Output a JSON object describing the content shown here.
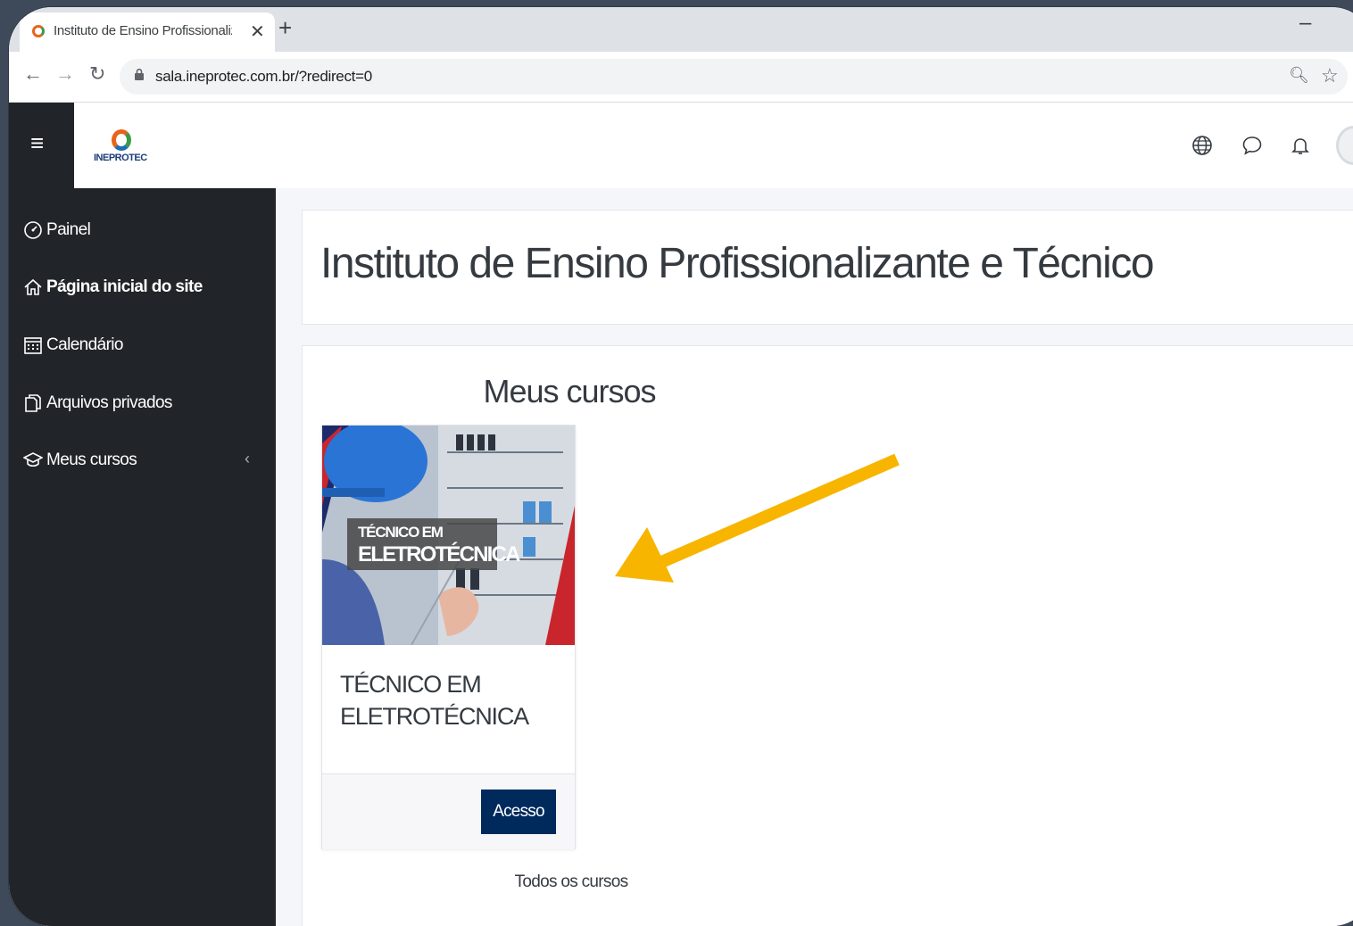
{
  "browser": {
    "tab_title": "Instituto de Ensino Profissionalizante e Técnico",
    "tab_close": "✕",
    "new_tab": "+",
    "minimize": "–",
    "url": "sala.ineprotec.com.br/?redirect=0"
  },
  "header": {
    "logo_text": "INEPROTEC"
  },
  "sidebar": {
    "items": [
      {
        "label": "Painel",
        "icon": "dashboard-icon"
      },
      {
        "label": "Página inicial do site",
        "icon": "home-icon"
      },
      {
        "label": "Calendário",
        "icon": "calendar-icon"
      },
      {
        "label": "Arquivos privados",
        "icon": "files-icon"
      },
      {
        "label": "Meus cursos",
        "icon": "graduation-cap-icon"
      }
    ]
  },
  "main": {
    "page_title": "Instituto de Ensino Profissionalizante e Técnico",
    "courses_heading": "Meus cursos",
    "course": {
      "image_line1": "TÉCNICO EM",
      "image_line2": "ELETROTÉCNICA",
      "name": "TÉCNICO EM ELETROTÉCNICA",
      "button_label": "Acesso"
    },
    "all_courses_label": "Todos os cursos"
  },
  "colors": {
    "sidebar_bg": "#212529",
    "button_bg": "#002a5c",
    "arrow": "#f7b500"
  }
}
